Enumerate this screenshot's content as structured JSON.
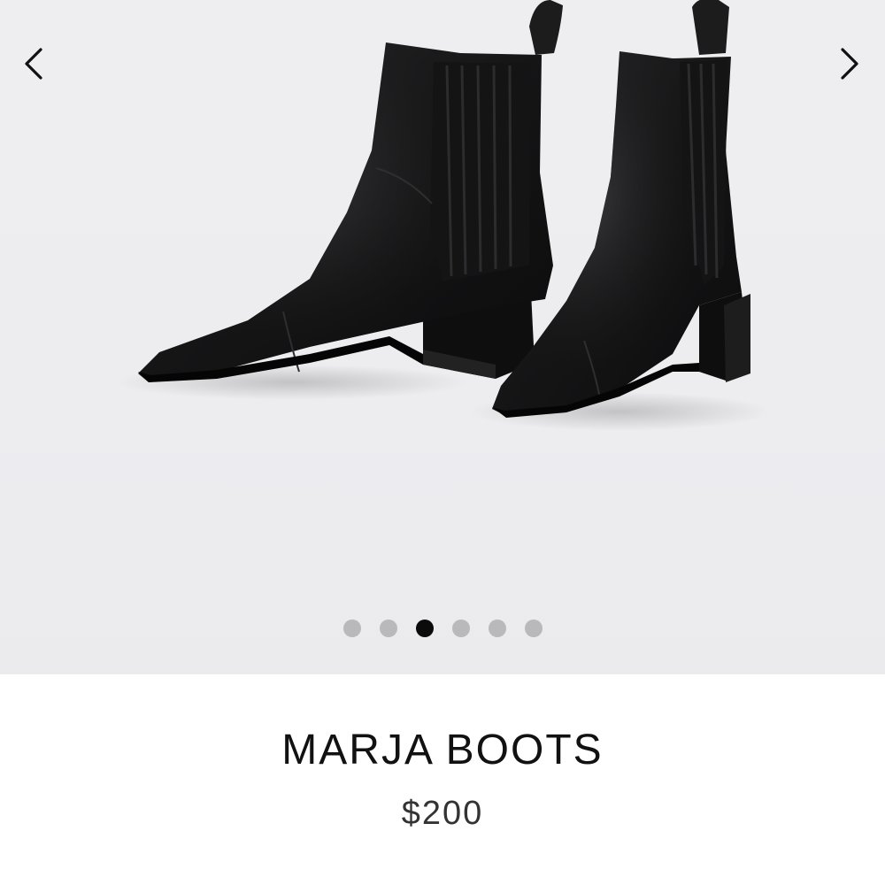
{
  "product": {
    "name": "MARJA BOOTS",
    "price": "$200"
  },
  "carousel": {
    "image_count": 6,
    "active_index": 2,
    "prev_icon": "chevron-left-icon",
    "next_icon": "chevron-right-icon"
  },
  "colors": {
    "background": "#ffffff",
    "image_backdrop": "#ededf0",
    "dot_inactive": "#b9b9bb",
    "dot_active": "#0b0b0b",
    "title": "#111111",
    "price": "#333333"
  }
}
